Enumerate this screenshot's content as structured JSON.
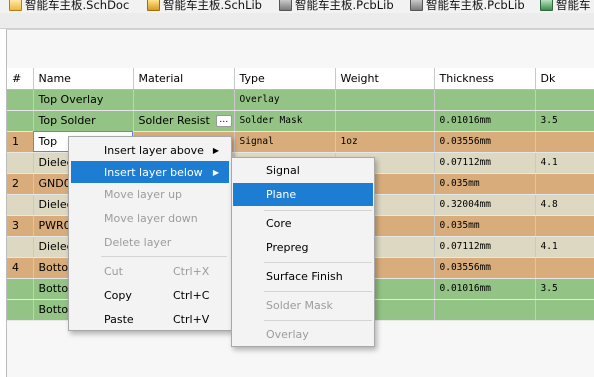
{
  "tabs": [
    {
      "label": "智能车主板.SchDoc",
      "icon": "schematic-document-icon"
    },
    {
      "label": "智能车主板.SchLib",
      "icon": "schematic-library-icon"
    },
    {
      "label": "智能车主板.PcbLib",
      "icon": "pcb-library-icon"
    },
    {
      "label": "智能车主板.PcbLib",
      "icon": "pcb-library-icon"
    },
    {
      "label": "智能车",
      "icon": "pcb-document-icon"
    }
  ],
  "columns": [
    "#",
    "Name",
    "Material",
    "Type",
    "Weight",
    "Thickness",
    "Dk"
  ],
  "rows": [
    {
      "num": "",
      "name": "Top Overlay",
      "material": "",
      "type": "Overlay",
      "weight": "",
      "thickness": "",
      "dk": "",
      "style": "green"
    },
    {
      "num": "",
      "name": "Top Solder",
      "material": "Solder Resist",
      "type": "Solder Mask",
      "weight": "",
      "thickness": "0.01016mm",
      "dk": "3.5",
      "style": "green",
      "has_button": true
    },
    {
      "num": "1",
      "name": "Top",
      "material": "",
      "type": "Signal",
      "weight": "1oz",
      "thickness": "0.03556mm",
      "dk": "",
      "style": "selected"
    },
    {
      "num": "",
      "name": "Dielec",
      "material": "",
      "type": "",
      "weight": "",
      "thickness": "0.07112mm",
      "dk": "4.1",
      "style": "tan"
    },
    {
      "num": "2",
      "name": "GND0",
      "material": "",
      "type": "",
      "weight": "",
      "thickness": "0.035mm",
      "dk": "",
      "style": "copper"
    },
    {
      "num": "",
      "name": "Dielec",
      "material": "",
      "type": "",
      "weight": "",
      "thickness": "0.32004mm",
      "dk": "4.8",
      "style": "tan"
    },
    {
      "num": "3",
      "name": "PWR0",
      "material": "",
      "type": "",
      "weight": "",
      "thickness": "0.035mm",
      "dk": "",
      "style": "copper"
    },
    {
      "num": "",
      "name": "Dielec",
      "material": "",
      "type": "",
      "weight": "",
      "thickness": "0.07112mm",
      "dk": "4.1",
      "style": "tan"
    },
    {
      "num": "4",
      "name": "Bottor",
      "material": "",
      "type": "",
      "weight": "",
      "thickness": "0.03556mm",
      "dk": "",
      "style": "copper"
    },
    {
      "num": "",
      "name": "Bottor",
      "material": "",
      "type": "",
      "weight": "",
      "thickness": "0.01016mm",
      "dk": "3.5",
      "style": "green"
    },
    {
      "num": "",
      "name": "Bottor",
      "material": "",
      "type": "",
      "weight": "",
      "thickness": "",
      "dk": "",
      "style": "green"
    }
  ],
  "context_menu": {
    "insert_above": "Insert layer above",
    "insert_below": "Insert layer below",
    "move_up": "Move layer up",
    "move_down": "Move layer down",
    "delete": "Delete layer",
    "cut": "Cut",
    "cut_accel": "Ctrl+X",
    "copy": "Copy",
    "copy_accel": "Ctrl+C",
    "paste": "Paste",
    "paste_accel": "Ctrl+V"
  },
  "submenu": {
    "signal": "Signal",
    "plane": "Plane",
    "core": "Core",
    "prepreg": "Prepreg",
    "surface_finish": "Surface Finish",
    "solder_mask": "Solder Mask",
    "overlay": "Overlay"
  },
  "colors": {
    "overlay_solder_row": "#93c385",
    "dielectric_row": "#dcd8c2",
    "copper_row": "#d8ad7b",
    "menu_highlight": "#1d7dd3"
  }
}
